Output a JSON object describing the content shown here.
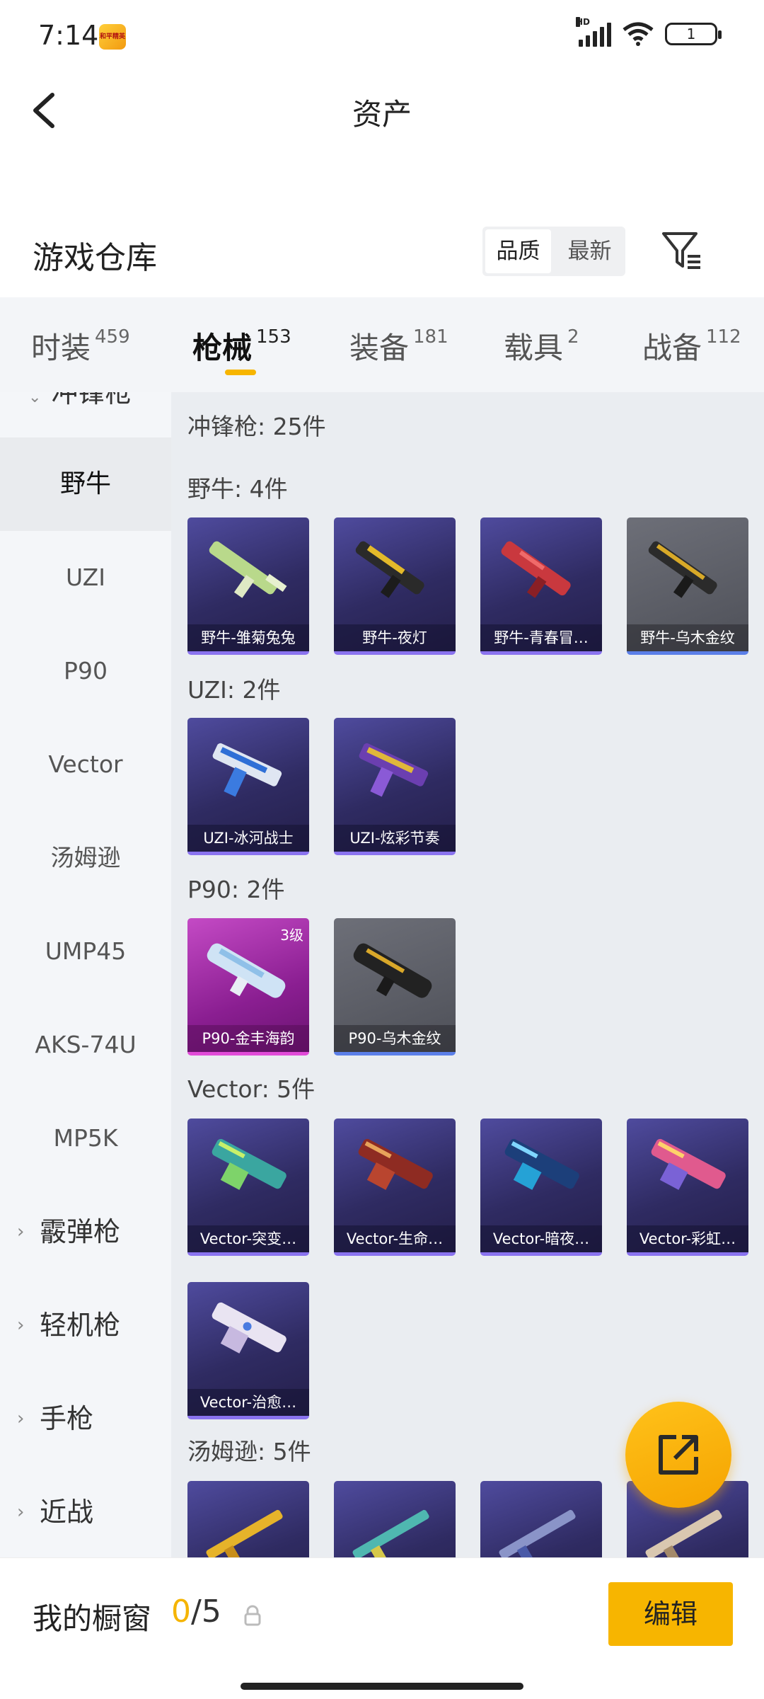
{
  "status": {
    "time": "7:14",
    "app_badge": "和平精英",
    "hd": "HD",
    "battery": "1"
  },
  "header": {
    "title": "资产"
  },
  "warehouse": {
    "title": "游戏仓库",
    "sort_quality": "品质",
    "sort_newest": "最新"
  },
  "tabs": [
    {
      "label": "时装",
      "count": "459"
    },
    {
      "label": "枪械",
      "count": "153"
    },
    {
      "label": "装备",
      "count": "181"
    },
    {
      "label": "载具",
      "count": "2"
    },
    {
      "label": "战备",
      "count": "112"
    }
  ],
  "sidebar": {
    "partial": "冲锋枪",
    "items": [
      "野牛",
      "UZI",
      "P90",
      "Vector",
      "汤姆逊",
      "UMP45",
      "AKS-74U",
      "MP5K"
    ],
    "categories": [
      "霰弹枪",
      "轻机枪",
      "手枪",
      "近战"
    ]
  },
  "content": {
    "summary": "冲锋枪: 25件",
    "sections": [
      {
        "title": "野牛: 4件",
        "items": [
          "野牛-雏菊兔兔",
          "野牛-夜灯",
          "野牛-青春冒…",
          "野牛-乌木金纹"
        ]
      },
      {
        "title": "UZI: 2件",
        "items": [
          "UZI-冰河战士",
          "UZI-炫彩节奏"
        ]
      },
      {
        "title": "P90: 2件",
        "items": [
          "P90-金丰海韵",
          "P90-乌木金纹"
        ],
        "level_badge": "3级"
      },
      {
        "title": "Vector: 5件",
        "items": [
          "Vector-突变…",
          "Vector-生命…",
          "Vector-暗夜…",
          "Vector-彩虹…",
          "Vector-治愈…"
        ]
      },
      {
        "title": "汤姆逊: 5件",
        "items": [
          "",
          "",
          "",
          ""
        ]
      }
    ]
  },
  "bottom": {
    "label": "我的橱窗",
    "current": "0",
    "total": "/5",
    "edit": "编辑"
  },
  "colors": {
    "accent": "#f7b500",
    "card_purple": "#2f2b62",
    "card_gray": "#55575f",
    "card_pink": "#a22aa8"
  }
}
